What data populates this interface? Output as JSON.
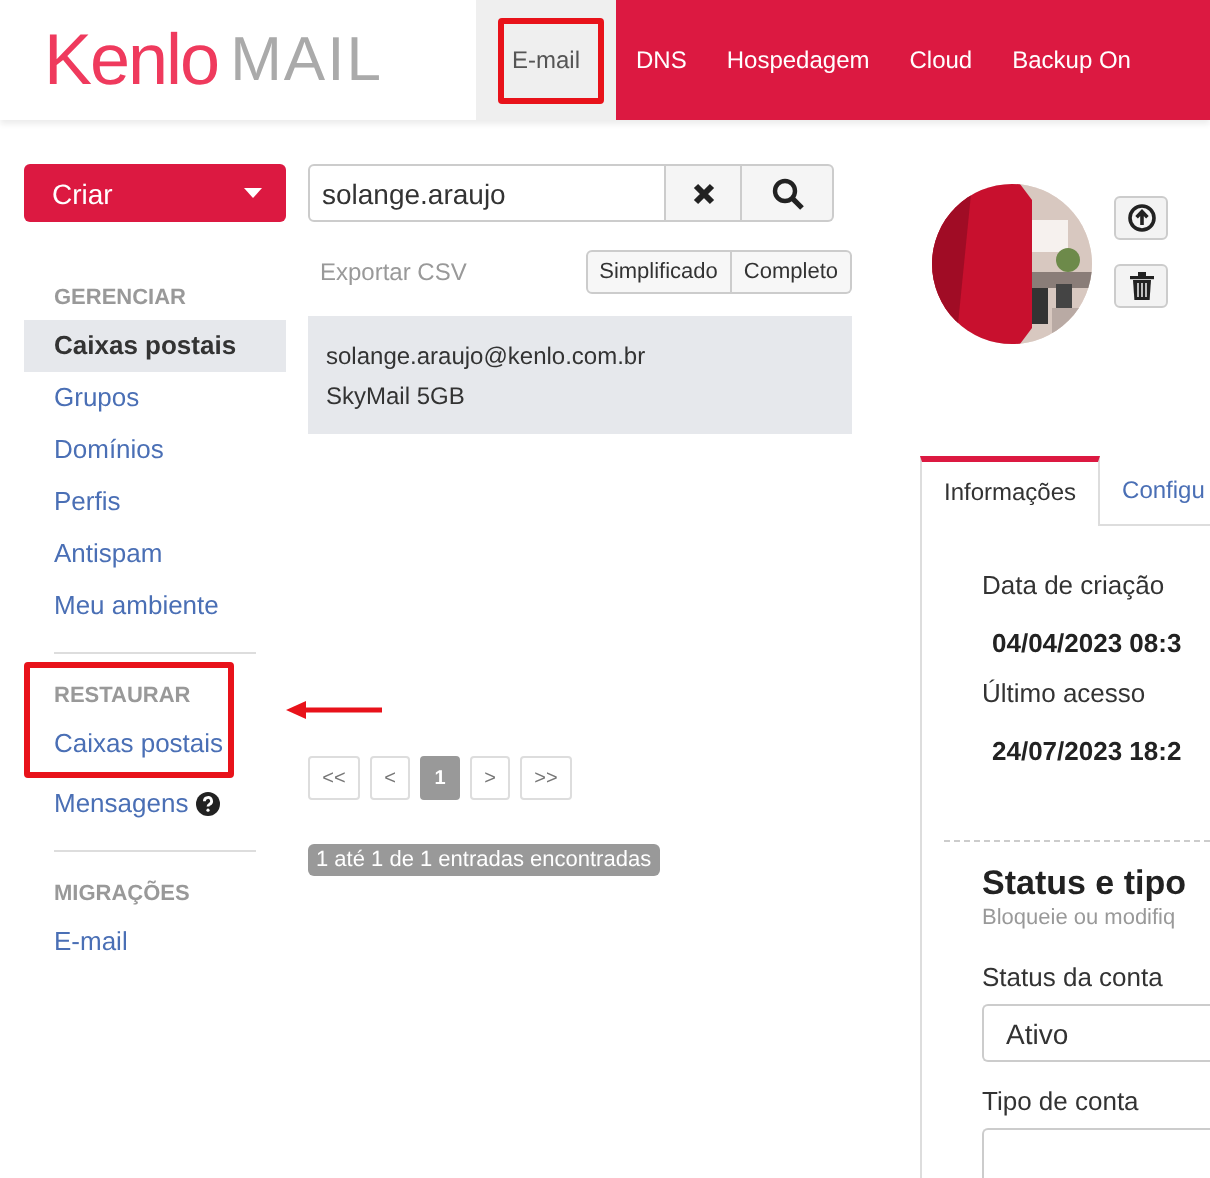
{
  "logo": {
    "brand": "Kenlo",
    "product": "MAIL"
  },
  "nav_tabs": [
    {
      "label": "E-mail",
      "selected": true,
      "highlighted": true
    },
    {
      "label": "DNS",
      "selected": false,
      "highlighted": false
    },
    {
      "label": "Hospedagem",
      "selected": false,
      "highlighted": false
    },
    {
      "label": "Cloud",
      "selected": false,
      "highlighted": false
    },
    {
      "label": "Backup On",
      "selected": false,
      "highlighted": false
    }
  ],
  "create_button": {
    "label": "Criar"
  },
  "sidebar": {
    "sections": [
      {
        "title": "GERENCIAR",
        "highlighted": false,
        "items": [
          {
            "label": "Caixas postais",
            "selected": true,
            "highlighted": false,
            "help": false
          },
          {
            "label": "Grupos",
            "selected": false,
            "highlighted": false,
            "help": false
          },
          {
            "label": "Domínios",
            "selected": false,
            "highlighted": false,
            "help": false
          },
          {
            "label": "Perfis",
            "selected": false,
            "highlighted": false,
            "help": false
          },
          {
            "label": "Antispam",
            "selected": false,
            "highlighted": false,
            "help": false
          },
          {
            "label": "Meu ambiente",
            "selected": false,
            "highlighted": false,
            "help": false
          }
        ]
      },
      {
        "title": "RESTAURAR",
        "highlighted": true,
        "items": [
          {
            "label": "Caixas postais",
            "selected": false,
            "highlighted": true,
            "help": false
          },
          {
            "label": "Mensagens",
            "selected": false,
            "highlighted": false,
            "help": true
          }
        ]
      },
      {
        "title": "MIGRAÇÕES",
        "highlighted": false,
        "items": [
          {
            "label": "E-mail",
            "selected": false,
            "highlighted": false,
            "help": false
          }
        ]
      }
    ]
  },
  "search": {
    "value": "solange.araujo"
  },
  "export_link": "Exportar CSV",
  "view_toggle": [
    {
      "label": "Simplificado",
      "selected": false
    },
    {
      "label": "Completo",
      "selected": false
    }
  ],
  "results": [
    {
      "email": "solange.araujo@kenlo.com.br",
      "plan": "SkyMail 5GB",
      "selected": true
    }
  ],
  "pagination": [
    {
      "label": "<<",
      "active": false
    },
    {
      "label": "<",
      "active": false
    },
    {
      "label": "1",
      "active": true
    },
    {
      "label": ">",
      "active": false
    },
    {
      "label": ">>",
      "active": false
    }
  ],
  "result_count": "1 até 1 de 1 entradas encontradas",
  "details": {
    "tabs": [
      {
        "label": "Informações",
        "selected": true
      },
      {
        "label": "Configu",
        "selected": false
      }
    ],
    "info": [
      {
        "label": "Data de criação",
        "value": "04/04/2023 08:3"
      },
      {
        "label": "Último acesso",
        "value": "24/07/2023 18:2"
      }
    ],
    "section": {
      "title": "Status e tipo",
      "subtitle": "Bloqueie ou modifiq"
    },
    "form": [
      {
        "label": "Status da conta",
        "value": "Ativo"
      },
      {
        "label": "Tipo de conta"
      }
    ]
  }
}
